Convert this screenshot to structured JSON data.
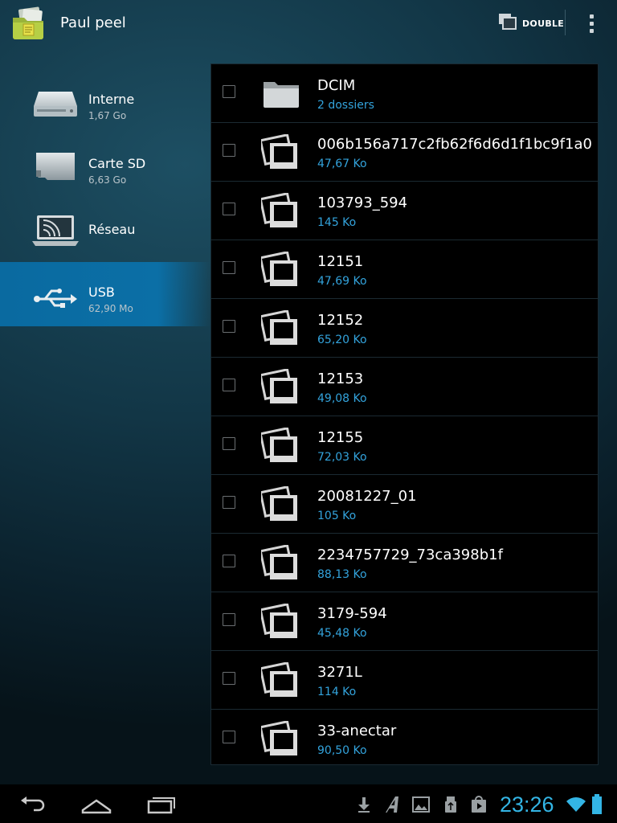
{
  "app": {
    "title": "Paul peel",
    "icon": "file-manager-app-icon"
  },
  "actionbar": {
    "double_label": "DOUBLE",
    "double_icon": "dual-pane-icon",
    "overflow_icon": "overflow-menu-icon"
  },
  "sidebar": {
    "items": [
      {
        "label": "Interne",
        "sub": "1,67 Go",
        "icon": "hard-drive-icon",
        "active": false
      },
      {
        "label": "Carte SD",
        "sub": "6,63 Go",
        "icon": "sd-card-icon",
        "active": false
      },
      {
        "label": "Réseau",
        "sub": "",
        "icon": "laptop-network-icon",
        "active": false
      },
      {
        "label": "USB",
        "sub": "62,90 Mo",
        "icon": "usb-icon",
        "active": true
      }
    ]
  },
  "files": [
    {
      "name": "DCIM",
      "sub": "2 dossiers",
      "type": "folder"
    },
    {
      "name": "006b156a717c2fb62f6d6d1f1bc9f1a0",
      "sub": "47,67 Ko",
      "type": "image"
    },
    {
      "name": "103793_594",
      "sub": "145 Ko",
      "type": "image"
    },
    {
      "name": "12151",
      "sub": "47,69 Ko",
      "type": "image"
    },
    {
      "name": "12152",
      "sub": "65,20 Ko",
      "type": "image"
    },
    {
      "name": "12153",
      "sub": "49,08 Ko",
      "type": "image"
    },
    {
      "name": "12155",
      "sub": "72,03 Ko",
      "type": "image"
    },
    {
      "name": "20081227_01",
      "sub": "105 Ko",
      "type": "image"
    },
    {
      "name": "2234757729_73ca398b1f",
      "sub": "88,13 Ko",
      "type": "image"
    },
    {
      "name": "3179-594",
      "sub": "45,48 Ko",
      "type": "image"
    },
    {
      "name": "3271L",
      "sub": "114 Ko",
      "type": "image"
    },
    {
      "name": "33-anectar",
      "sub": "90,50 Ko",
      "type": "image"
    }
  ],
  "statusbar": {
    "time": "23:26",
    "accent": "#33b5e5"
  },
  "colors": {
    "accent_blue": "#33a3dc",
    "selected_bg": "#0b6fa6"
  }
}
